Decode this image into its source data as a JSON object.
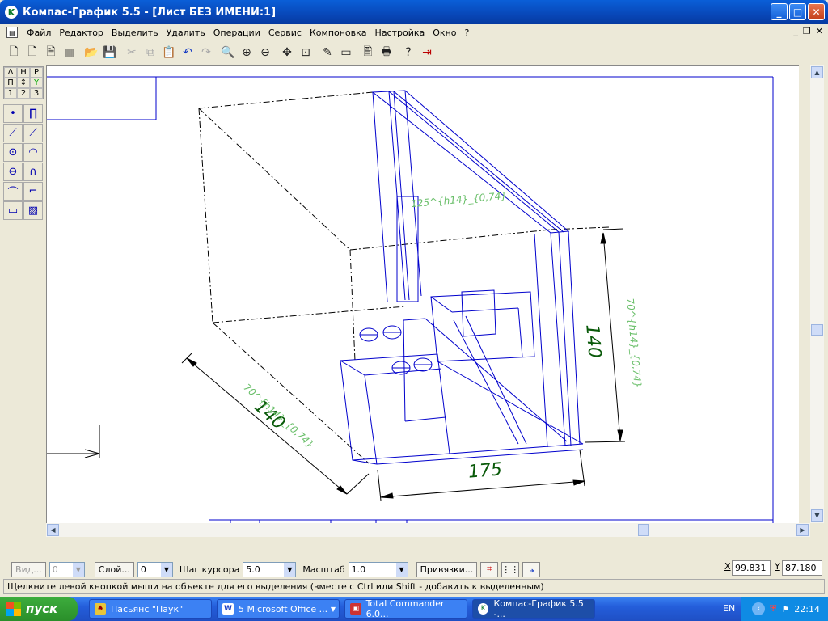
{
  "window": {
    "title": "Компас-График 5.5 - [Лист БЕЗ ИМЕНИ:1]"
  },
  "menu": [
    "Файл",
    "Редактор",
    "Выделить",
    "Удалить",
    "Операции",
    "Сервис",
    "Компоновка",
    "Настройка",
    "Окно",
    "?"
  ],
  "toolbar_icons": [
    "new-sheet-icon",
    "new-fragment-icon",
    "new-document-icon",
    "new-spec-icon",
    "open-icon",
    "save-icon",
    "cut-icon",
    "copy-icon",
    "paste-icon",
    "undo-icon",
    "redo-icon",
    "zoom-icon",
    "zoom-in-icon",
    "zoom-out-icon",
    "pan-icon",
    "zoom-fit-icon",
    "properties-icon",
    "view-manager-icon",
    "print-preview-icon",
    "print-icon",
    "help-icon",
    "exit-icon"
  ],
  "left_panel": {
    "tabs": [
      "Δ",
      "H",
      "P",
      "П",
      "↕",
      "Y",
      "1",
      "2",
      "3"
    ]
  },
  "drawing": {
    "dimensions": [
      "175",
      "140",
      "140"
    ],
    "roughness_notes": [
      "70^{h14}_{0,74}",
      "70^{h14}_{0,74}",
      "125^{h14}_{0,74}"
    ],
    "line_color": "#0000cc",
    "text_color": "#006600"
  },
  "bottom": {
    "view_label": "Вид...",
    "view_value": "0",
    "layer_label": "Слой...",
    "layer_value": "0",
    "cursor_step_label": "Шаг курсора",
    "cursor_step_value": "5.0",
    "scale_label": "Масштаб",
    "scale_value": "1.0",
    "snaps_label": "Привязки...",
    "x_label": "X",
    "x_value": "99.831",
    "y_label": "Y",
    "y_value": "87.180"
  },
  "status": "Щелкните левой кнопкой мыши на объекте для его выделения (вместе с Ctrl или Shift - добавить к выделенным)",
  "taskbar": {
    "start": "пуск",
    "tasks": [
      "Пасьянс \"Паук\"",
      "5 Microsoft Office ...",
      "Total Commander 6.0...",
      "Компас-График 5.5 -..."
    ],
    "lang": "EN",
    "clock": "22:14"
  }
}
